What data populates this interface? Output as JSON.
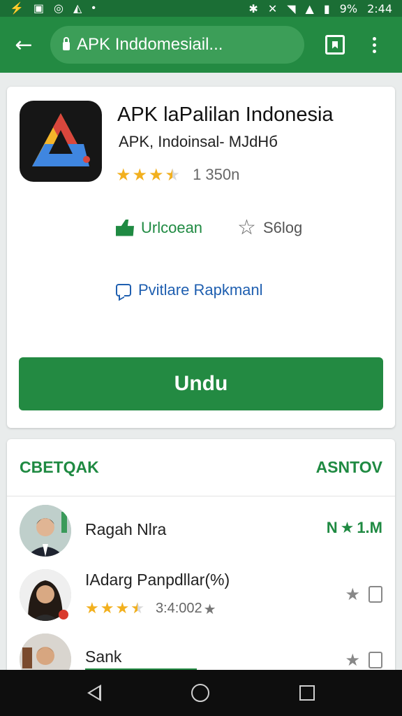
{
  "status_bar": {
    "battery": "9%",
    "time": "2:44"
  },
  "browser": {
    "url": "APK Inddomesiail...",
    "icons": [
      "back-arrow-icon",
      "lock-icon",
      "bookmark-icon",
      "more-vert-icon"
    ]
  },
  "app": {
    "title": "APK laPalilan Indonesia",
    "subtitle": "APK, Indoinsal- MJdНб",
    "rating_stars": 3.5,
    "rating_count": "1 350n",
    "like_label": "Urlcoean",
    "star_label": "S6log",
    "share_label": "Pvitlare Rapkmanl",
    "install_label": "Undu"
  },
  "reviews": {
    "left_tab": "CBETQAK",
    "right_tab": "ASNTOV",
    "items": [
      {
        "name": "Ragah Nlra",
        "meta": "1.M",
        "meta_prefix": "N"
      },
      {
        "name": "IAdarg Panpdllar(%)",
        "stars": 3.5,
        "count": "3:4:002"
      },
      {
        "name": "Sank"
      }
    ]
  },
  "colors": {
    "brand_green": "#238a42",
    "status_green": "#1b6e35",
    "star_yellow": "#f2b01e",
    "link_blue": "#1f5fb0"
  }
}
